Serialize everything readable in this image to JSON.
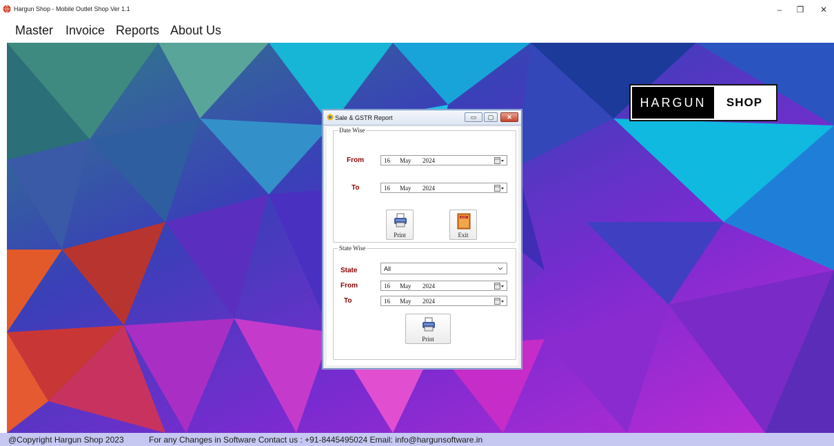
{
  "window": {
    "title": "Hargun Shop - Mobile Outlet Shop Ver 1.1",
    "icon": "app-globe-icon",
    "controls": {
      "minimize": "–",
      "maximize": "❐",
      "close": "✕"
    }
  },
  "menu": {
    "items": [
      {
        "label": "Master"
      },
      {
        "label": "Invoice"
      },
      {
        "label": "Reports"
      },
      {
        "label": "About Us"
      }
    ]
  },
  "logo": {
    "left_text": "HARGUN",
    "right_text": "SHOP"
  },
  "dialog": {
    "title": "Sale & GSTR Report",
    "controls": {
      "minimize": "▭",
      "maximize": "▢",
      "close": "✕"
    },
    "date_wise": {
      "legend": "Date Wise",
      "from_label": "From",
      "from_date": {
        "day": "16",
        "month": "May",
        "year": "2024"
      },
      "to_label": "To",
      "to_date": {
        "day": "16",
        "month": "May",
        "year": "2024"
      },
      "print_label": "Print",
      "exit_label": "Exit",
      "exit_icon_text": "EXIT"
    },
    "state_wise": {
      "legend": "State Wise",
      "state_label": "State",
      "state_value": "All",
      "from_label": "From",
      "from_date": {
        "day": "16",
        "month": "May",
        "year": "2024"
      },
      "to_label": "To",
      "to_date": {
        "day": "16",
        "month": "May",
        "year": "2024"
      },
      "print_label": "Print"
    }
  },
  "status": {
    "copyright": "@Copyright Hargun Shop 2023",
    "contact": "For any Changes in Software Contact us : +91-8445495024 Email: info@hargunsoftware.in"
  },
  "colors": {
    "label_red": "#8b0000",
    "status_bar": "#c6c8f2",
    "dialog_border": "#6a8bbf"
  }
}
